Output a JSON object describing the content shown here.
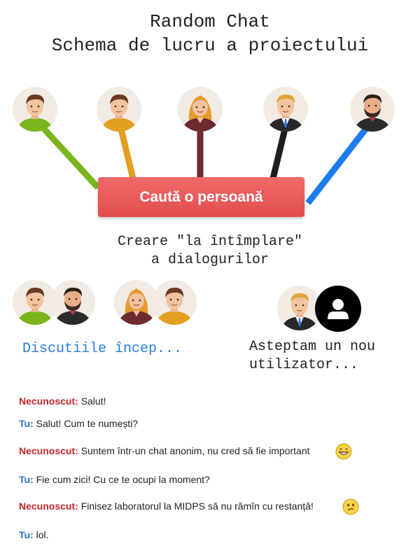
{
  "header": {
    "title": "Random Chat",
    "subtitle": "Schema de lucru a proiectului"
  },
  "search_button": {
    "label": "Caută o persoană"
  },
  "random_caption": {
    "line1": "Creare \"la întîmplare\"",
    "line2": "a dialogurilor"
  },
  "pairs": {
    "discussions_label": "Discutiile încep...",
    "waiting_line1": "Asteptam un nou",
    "waiting_line2": "utilizator..."
  },
  "colors": {
    "line_green": "#7ab51d",
    "line_orange": "#e2a020",
    "line_maroon": "#6d2b2f",
    "line_black": "#1e1e1e",
    "line_blue": "#1c7cf0",
    "button": "#e85655",
    "stranger": "#c0262b",
    "me": "#2a74c7"
  },
  "chat": [
    {
      "speaker": "Necunoscut:",
      "role": "stranger",
      "text": "Salut!"
    },
    {
      "speaker": "Tu:",
      "role": "me",
      "text": "Salut! Cum te numești?"
    },
    {
      "speaker": "Necunoscut:",
      "role": "stranger",
      "text": "Suntem într-un chat anonim, nu cred să fie important",
      "emoji": "grinning-emoji"
    },
    {
      "speaker": "Tu:",
      "role": "me",
      "text": "Fie cum zici! Cu ce te ocupi la moment?"
    },
    {
      "speaker": "Necunoscut:",
      "role": "stranger",
      "text": "Finisez laboratorul la MIDPS să nu rămîn cu restanță!",
      "emoji": "confused-emoji"
    },
    {
      "speaker": "Tu:",
      "role": "me",
      "text": "lol."
    }
  ]
}
